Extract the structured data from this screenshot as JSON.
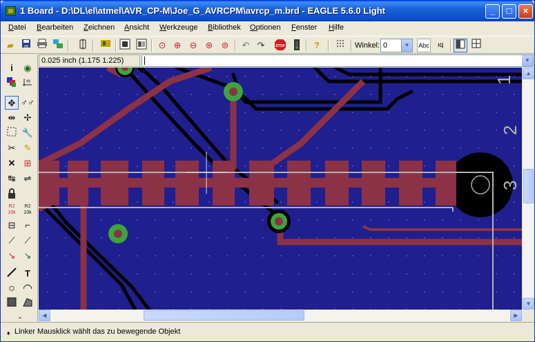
{
  "window": {
    "title": "1 Board - D:\\DL\\el\\atmel\\AVR_CP-M\\Joe_G_AVRCPM\\avrcp_m.brd - EAGLE 5.6.0 Light",
    "minimize_label": "_",
    "maximize_label": "□",
    "close_label": "×"
  },
  "menu": {
    "items": [
      "Datei",
      "Bearbeiten",
      "Zeichnen",
      "Ansicht",
      "Werkzeuge",
      "Bibliothek",
      "Optionen",
      "Fenster",
      "Hilfe"
    ]
  },
  "toolbar": {
    "winkel_label": "Winkel:",
    "winkel_value": "0",
    "icons": [
      "open-icon",
      "save-icon",
      "print-icon",
      "cam-icon",
      "grid-layers-icon",
      "board-icon",
      "schematic-icon",
      "ulp-icon",
      "zoom-fit-icon",
      "zoom-in-icon",
      "zoom-out-icon",
      "zoom-redraw-icon",
      "zoom-select-icon",
      "undo-icon",
      "redo-icon",
      "stop-icon",
      "go-icon",
      "help-icon",
      "grid-icon",
      "text-size-icon",
      "text-ratio-icon",
      "layout-a-icon",
      "layout-b-icon"
    ]
  },
  "command": {
    "coordinates": "0.025 inch (1.175 1.225)",
    "input_value": ""
  },
  "palette": {
    "icons": [
      "info-icon",
      "show-icon",
      "display-icon",
      "mark-icon",
      "move-icon",
      "copy-icon",
      "mirror-icon",
      "rotate-icon",
      "group-icon",
      "change-icon",
      "cut-icon",
      "paste-icon",
      "delete-icon",
      "add-icon",
      "pinswap-icon",
      "gateswap-icon",
      "lock-icon",
      "name-icon",
      "value-icon",
      "smash-icon",
      "miter-icon",
      "split-icon",
      "optimize-icon",
      "route-icon",
      "ripup-icon",
      "wire-icon",
      "text-icon",
      "circle-icon",
      "arc-icon",
      "rect-icon",
      "polygon-icon",
      "more-icon"
    ]
  },
  "board": {
    "pad_labels": [
      "1",
      "2",
      "3"
    ],
    "colors": {
      "background": "#1f1f8f",
      "top_copper": "#8c3246",
      "bottom_copper": "#000000",
      "via_ring": "#3ca53c",
      "outline": "#b4b4b4"
    }
  },
  "status": {
    "icon": "status-arrow-icon",
    "text": "Linker Mausklick wählt das zu bewegende Objekt"
  }
}
